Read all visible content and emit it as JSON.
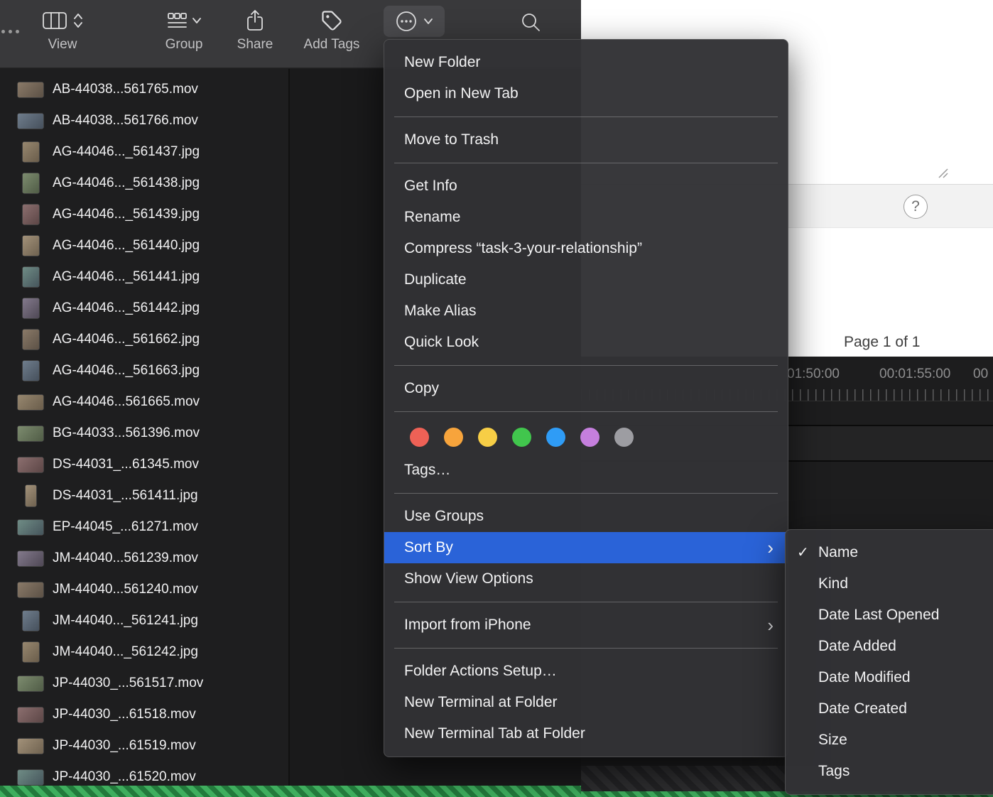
{
  "toolbar": {
    "items": [
      {
        "label": "View"
      },
      {
        "label": "Group"
      },
      {
        "label": "Share"
      },
      {
        "label": "Add Tags"
      }
    ]
  },
  "file_list": [
    {
      "name": "AB-44038...561765.mov",
      "kind": "mov"
    },
    {
      "name": "AB-44038...561766.mov",
      "kind": "mov"
    },
    {
      "name": "AG-44046..._561437.jpg",
      "kind": "jpg"
    },
    {
      "name": "AG-44046..._561438.jpg",
      "kind": "jpg"
    },
    {
      "name": "AG-44046..._561439.jpg",
      "kind": "jpg"
    },
    {
      "name": "AG-44046..._561440.jpg",
      "kind": "jpg"
    },
    {
      "name": "AG-44046..._561441.jpg",
      "kind": "jpg"
    },
    {
      "name": "AG-44046..._561442.jpg",
      "kind": "jpg"
    },
    {
      "name": "AG-44046..._561662.jpg",
      "kind": "jpg"
    },
    {
      "name": "AG-44046..._561663.jpg",
      "kind": "jpg"
    },
    {
      "name": "AG-44046...561665.mov",
      "kind": "mov"
    },
    {
      "name": "BG-44033...561396.mov",
      "kind": "mov"
    },
    {
      "name": "DS-44031_...61345.mov",
      "kind": "mov"
    },
    {
      "name": "DS-44031_...561411.jpg",
      "kind": "jpg",
      "tall": true
    },
    {
      "name": "EP-44045_...61271.mov",
      "kind": "mov"
    },
    {
      "name": "JM-44040...561239.mov",
      "kind": "mov"
    },
    {
      "name": "JM-44040...561240.mov",
      "kind": "mov"
    },
    {
      "name": "JM-44040..._561241.jpg",
      "kind": "jpg"
    },
    {
      "name": "JM-44040..._561242.jpg",
      "kind": "jpg"
    },
    {
      "name": "JP-44030_...561517.mov",
      "kind": "mov"
    },
    {
      "name": "JP-44030_...61518.mov",
      "kind": "mov"
    },
    {
      "name": "JP-44030_...61519.mov",
      "kind": "mov"
    },
    {
      "name": "JP-44030_...61520.mov",
      "kind": "mov"
    }
  ],
  "context_menu": {
    "accent_color": "#2a63d8",
    "groups": [
      [
        {
          "label": "New Folder"
        },
        {
          "label": "Open in New Tab"
        }
      ],
      [
        {
          "label": "Move to Trash"
        }
      ],
      [
        {
          "label": "Get Info"
        },
        {
          "label": "Rename"
        },
        {
          "label": "Compress “task-3-your-relationship”"
        },
        {
          "label": "Duplicate"
        },
        {
          "label": "Make Alias"
        },
        {
          "label": "Quick Look"
        }
      ],
      [
        {
          "label": "Copy"
        }
      ],
      [
        {
          "type": "tag-colors",
          "colors": [
            {
              "name": "red",
              "hex": "#ee6156"
            },
            {
              "name": "orange",
              "hex": "#f7a43c"
            },
            {
              "name": "yellow",
              "hex": "#f7ce46"
            },
            {
              "name": "green",
              "hex": "#41c64d"
            },
            {
              "name": "blue",
              "hex": "#2f9cf6"
            },
            {
              "name": "purple",
              "hex": "#c57fdd"
            },
            {
              "name": "gray",
              "hex": "#9d9da2"
            }
          ]
        },
        {
          "label": "Tags…"
        }
      ],
      [
        {
          "label": "Use Groups"
        },
        {
          "label": "Sort By",
          "highlighted": true,
          "submenu": true
        },
        {
          "label": "Show View Options"
        }
      ],
      [
        {
          "label": "Import from iPhone",
          "submenu": true
        }
      ],
      [
        {
          "label": "Folder Actions Setup…"
        },
        {
          "label": "New Terminal at Folder"
        },
        {
          "label": "New Terminal Tab at Folder"
        }
      ]
    ]
  },
  "sort_submenu": {
    "items": [
      {
        "label": "Name",
        "checked": true
      },
      {
        "label": "Kind"
      },
      {
        "label": "Date Last Opened"
      },
      {
        "label": "Date Added"
      },
      {
        "label": "Date Modified"
      },
      {
        "label": "Date Created"
      },
      {
        "label": "Size"
      },
      {
        "label": "Tags"
      }
    ]
  },
  "preview": {
    "page_indicator": "Page 1 of 1",
    "help_label": "?"
  },
  "timeline": {
    "timecodes": [
      "01:50:00",
      "00:01:55:00",
      "00"
    ]
  }
}
